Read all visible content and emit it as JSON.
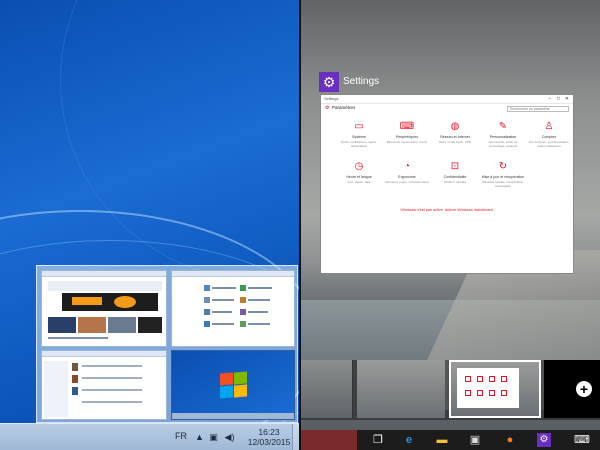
{
  "left_screen": {
    "taskbar": {
      "language": "FR",
      "clock_time": "16:23",
      "clock_date": "12/03/2015"
    }
  },
  "right_screen": {
    "app_title": "Settings",
    "settings_window": {
      "window_title": "Settings",
      "header": "Paramètres",
      "search_placeholder": "Rechercher un paramètre",
      "categories": [
        {
          "label": "Système",
          "sub": "Écran, notifications, applis, alimentation",
          "icon": "monitor-icon"
        },
        {
          "label": "Périphériques",
          "sub": "Bluetooth, imprimantes, souris",
          "icon": "devices-icon"
        },
        {
          "label": "Réseau et Internet",
          "sub": "Wi-Fi, mode Avion, VPN",
          "icon": "globe-icon"
        },
        {
          "label": "Personnalisation",
          "sub": "Arrière-plan, écran de verrouillage, couleurs",
          "icon": "paint-icon"
        },
        {
          "label": "Comptes",
          "sub": "Vos comptes, synchronisation, autres utilisateurs",
          "icon": "person-icon"
        },
        {
          "label": "Heure et langue",
          "sub": "Voix, région, date",
          "icon": "clock-icon"
        },
        {
          "label": "Ergonomie",
          "sub": "Narrateur, loupe, contraste élevé",
          "icon": "ease-icon"
        },
        {
          "label": "Confidentialité",
          "sub": "Position, caméra",
          "icon": "lock-icon"
        },
        {
          "label": "Mise à jour et récupération",
          "sub": "Windows Update, récupération, sauvegarde",
          "icon": "refresh-icon"
        }
      ],
      "link_text": "Windows n'est pas activé. Activer Windows maintenant."
    },
    "new_desktop_glyph": "+"
  },
  "colors": {
    "win7_blue": "#1a6cd3",
    "settings_accent": "#e81123",
    "settings_tile": "#6b2fbf",
    "taskbar10": "#1c1c1c"
  }
}
